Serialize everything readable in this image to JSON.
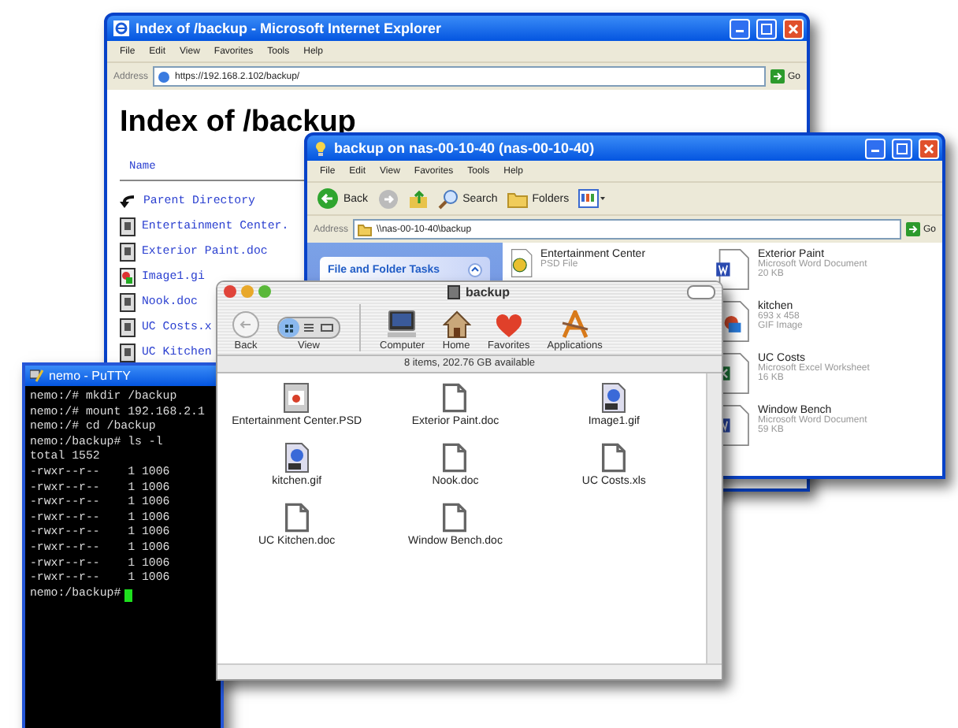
{
  "ie_window": {
    "title": "Index of /backup - Microsoft Internet Explorer",
    "menu": [
      "File",
      "Edit",
      "View",
      "Favorites",
      "Tools",
      "Help"
    ],
    "address_label": "Address",
    "address": "https://192.168.2.102/backup/",
    "go": "Go",
    "heading": "Index of /backup",
    "column_header": "Name",
    "listing": [
      {
        "kind": "parent",
        "name": "Parent Directory"
      },
      {
        "kind": "file",
        "name": "Entertainment Center."
      },
      {
        "kind": "file",
        "name": "Exterior Paint.doc"
      },
      {
        "kind": "image",
        "name": "Image1.gi"
      },
      {
        "kind": "file",
        "name": "Nook.doc"
      },
      {
        "kind": "file",
        "name": "UC Costs.x"
      },
      {
        "kind": "file",
        "name": "UC Kitchen"
      }
    ]
  },
  "explorer_window": {
    "title": "backup on nas-00-10-40 (nas-00-10-40)",
    "menu": [
      "File",
      "Edit",
      "View",
      "Favorites",
      "Tools",
      "Help"
    ],
    "toolbar": [
      {
        "kind": "back",
        "label": "Back"
      },
      {
        "kind": "forward"
      },
      {
        "kind": "up"
      },
      {
        "kind": "search",
        "label": "Search"
      },
      {
        "kind": "folders",
        "label": "Folders"
      },
      {
        "kind": "views"
      }
    ],
    "address_label": "Address",
    "address": "\\\\nas-00-10-40\\backup",
    "go": "Go",
    "task_panel_title": "File and Folder Tasks",
    "files": [
      {
        "kind": "psd",
        "name": "Entertainment Center",
        "details": [
          "PSD File"
        ]
      },
      {
        "kind": "word",
        "name": "Exterior Paint",
        "details": [
          "Microsoft Word Document",
          "20 KB"
        ]
      },
      {
        "kind": "gif",
        "name": "kitchen",
        "details": [
          "693 x 458",
          "GIF Image"
        ]
      },
      {
        "kind": "excel",
        "name": "UC Costs",
        "details": [
          "Microsoft Excel Worksheet",
          "16 KB"
        ]
      },
      {
        "kind": "word",
        "name": "Window Bench",
        "details": [
          "Microsoft Word Document",
          "59 KB"
        ]
      }
    ]
  },
  "terminal_window": {
    "title": "nemo - PuTTY",
    "lines": [
      "nemo:/# mkdir /backup",
      "nemo:/# mount 192.168.2.1",
      "nemo:/# cd /backup",
      "nemo:/backup# ls -l",
      "total 1552",
      "-rwxr--r--    1 1006",
      "-rwxr--r--    1 1006",
      "-rwxr--r--    1 1006",
      "-rwxr--r--    1 1006",
      "-rwxr--r--    1 1006",
      "-rwxr--r--    1 1006",
      "-rwxr--r--    1 1006",
      "-rwxr--r--    1 1006",
      "nemo:/backup#"
    ]
  },
  "finder_window": {
    "title": "backup",
    "toolbar": [
      {
        "kind": "back",
        "label": "Back"
      },
      {
        "kind": "view",
        "label": "View"
      },
      {
        "kind": "computer",
        "label": "Computer"
      },
      {
        "kind": "home",
        "label": "Home"
      },
      {
        "kind": "favorites",
        "label": "Favorites"
      },
      {
        "kind": "applications",
        "label": "Applications"
      }
    ],
    "status": "8 items, 202.76 GB available",
    "files": [
      {
        "kind": "psd",
        "name": "Entertainment Center.PSD"
      },
      {
        "kind": "doc",
        "name": "Exterior Paint.doc"
      },
      {
        "kind": "gif",
        "name": "Image1.gif"
      },
      {
        "kind": "gif",
        "name": "kitchen.gif"
      },
      {
        "kind": "doc",
        "name": "Nook.doc"
      },
      {
        "kind": "doc",
        "name": "UC Costs.xls"
      },
      {
        "kind": "doc",
        "name": "UC Kitchen.doc"
      },
      {
        "kind": "doc",
        "name": "Window Bench.doc"
      }
    ]
  }
}
